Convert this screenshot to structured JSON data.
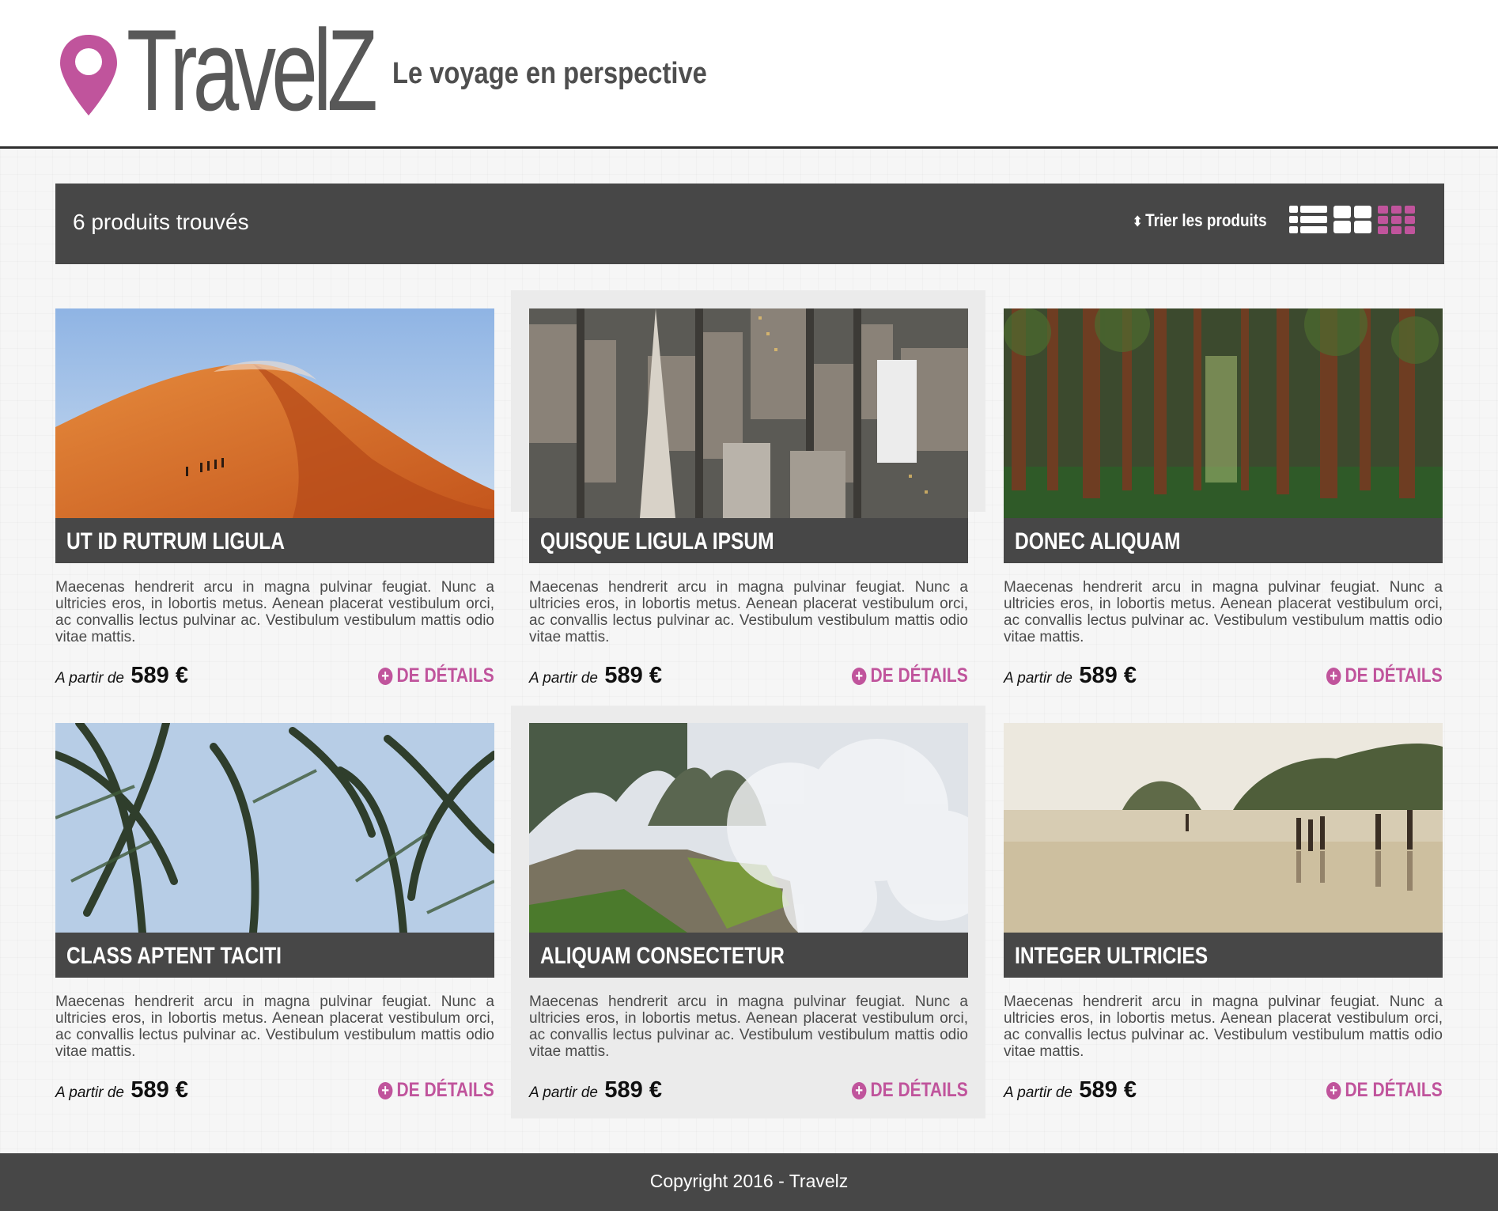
{
  "brand": {
    "name": "TravelZ",
    "tagline": "Le voyage en perspective",
    "accent_color": "#c0549c",
    "dark_color": "#474747"
  },
  "toolbar": {
    "result_count": "6 produits trouvés",
    "sort_label": "Trier les produits",
    "sort_icon": "sort-icon",
    "view_modes": [
      "list-view-icon",
      "grid-2-view-icon",
      "grid-3-view-icon"
    ],
    "active_view": "grid-3-view-icon"
  },
  "products": [
    {
      "title": "Ut id rutrum ligula",
      "image": "desert-dunes",
      "description": "Maecenas hendrerit arcu in magna pulvinar feugiat. Nunc a ultricies eros, in lobortis metus. Aenean placerat vestibulum orci, ac convallis lectus pulvinar ac. Vestibulum vestibulum mattis odio vitae mattis.",
      "price_prefix": "A partir de",
      "price": "589 €",
      "details_label": "DE DÉTAILS"
    },
    {
      "title": "Quisque ligula ipsum",
      "image": "city-aerial",
      "description": "Maecenas hendrerit arcu in magna pulvinar feugiat. Nunc a ultricies eros, in lobortis metus. Aenean placerat vestibulum orci, ac convallis lectus pulvinar ac. Vestibulum vestibulum mattis odio vitae mattis.",
      "price_prefix": "A partir de",
      "price": "589 €",
      "details_label": "DE DÉTAILS"
    },
    {
      "title": "Donec aliquam",
      "image": "forest",
      "description": "Maecenas hendrerit arcu in magna pulvinar feugiat. Nunc a ultricies eros, in lobortis metus. Aenean placerat vestibulum orci, ac convallis lectus pulvinar ac. Vestibulum vestibulum mattis odio vitae mattis.",
      "price_prefix": "A partir de",
      "price": "589 €",
      "details_label": "DE DÉTAILS"
    },
    {
      "title": "Class aptent taciti",
      "image": "palm-trees",
      "description": "Maecenas hendrerit arcu in magna pulvinar feugiat. Nunc a ultricies eros, in lobortis metus. Aenean placerat vestibulum orci, ac convallis lectus pulvinar ac. Vestibulum vestibulum mattis odio vitae mattis.",
      "price_prefix": "A partir de",
      "price": "589 €",
      "details_label": "DE DÉTAILS"
    },
    {
      "title": "Aliquam consectetur",
      "image": "mountain-ruins",
      "description": "Maecenas hendrerit arcu in magna pulvinar feugiat. Nunc a ultricies eros, in lobortis metus. Aenean placerat vestibulum orci, ac convallis lectus pulvinar ac. Vestibulum vestibulum mattis odio vitae mattis.",
      "price_prefix": "A partir de",
      "price": "589 €",
      "details_label": "DE DÉTAILS"
    },
    {
      "title": "Integer ultricies",
      "image": "beach",
      "description": "Maecenas hendrerit arcu in magna pulvinar feugiat. Nunc a ultricies eros, in lobortis metus. Aenean placerat vestibulum orci, ac convallis lectus pulvinar ac. Vestibulum vestibulum mattis odio vitae mattis.",
      "price_prefix": "A partir de",
      "price": "589 €",
      "details_label": "DE DÉTAILS"
    }
  ],
  "footer": {
    "copyright": "Copyright 2016 - Travelz"
  }
}
